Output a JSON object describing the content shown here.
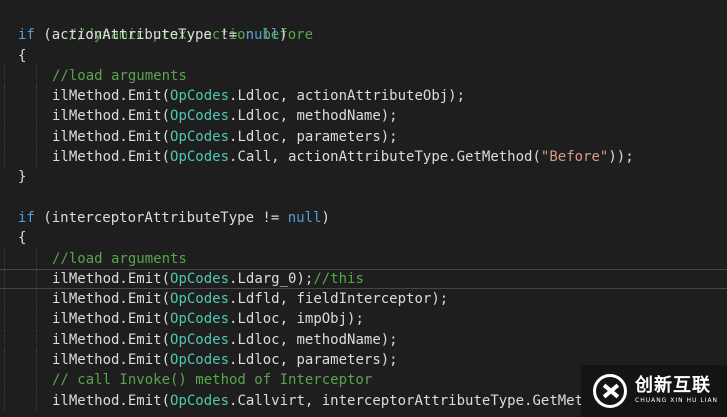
{
  "colors": {
    "background": "#1e1e1e",
    "keyword": "#569cd6",
    "comment": "#57a64a",
    "type": "#4ec9b0",
    "string": "#d69d85",
    "plain": "#dcdcdc"
  },
  "code": {
    "l1_comment": "//dynamic proxy action before",
    "l2_if": "if",
    "l2_rest": " (actionAttributeType != ",
    "l2_null": "null",
    "l2_close": ")",
    "l3_brace": "{",
    "l4_comment": "//load arguments",
    "l5_pre": "ilMethod.Emit(",
    "l5_type": "OpCodes",
    "l5_post": ".Ldloc, actionAttributeObj);",
    "l6_pre": "ilMethod.Emit(",
    "l6_type": "OpCodes",
    "l6_post": ".Ldloc, methodName);",
    "l7_pre": "ilMethod.Emit(",
    "l7_type": "OpCodes",
    "l7_post": ".Ldloc, parameters);",
    "l8_pre": "ilMethod.Emit(",
    "l8_type": "OpCodes",
    "l8_mid": ".Call, actionAttributeType.GetMethod(",
    "l8_str": "\"Before\"",
    "l8_post": "));",
    "l9_brace": "}",
    "l11_if": "if",
    "l11_rest": " (interceptorAttributeType != ",
    "l11_null": "null",
    "l11_close": ")",
    "l12_brace": "{",
    "l13_comment": "//load arguments",
    "l14_pre": "ilMethod.Emit(",
    "l14_type": "OpCodes",
    "l14_post": ".Ldarg_0);",
    "l14_comment": "//this",
    "l15_pre": "ilMethod.Emit(",
    "l15_type": "OpCodes",
    "l15_post": ".Ldfld, fieldInterceptor);",
    "l16_pre": "ilMethod.Emit(",
    "l16_type": "OpCodes",
    "l16_post": ".Ldloc, impObj);",
    "l17_pre": "ilMethod.Emit(",
    "l17_type": "OpCodes",
    "l17_post": ".Ldloc, methodName);",
    "l18_pre": "ilMethod.Emit(",
    "l18_type": "OpCodes",
    "l18_post": ".Ldloc, parameters);",
    "l19_comment": "// call Invoke() method of Interceptor",
    "l20_pre": "ilMethod.Emit(",
    "l20_type": "OpCodes",
    "l20_post": ".Callvirt, interceptorAttributeType.GetMet"
  },
  "watermark": {
    "cn": "创新互联",
    "en": "CHUANG XIN HU LIAN"
  }
}
